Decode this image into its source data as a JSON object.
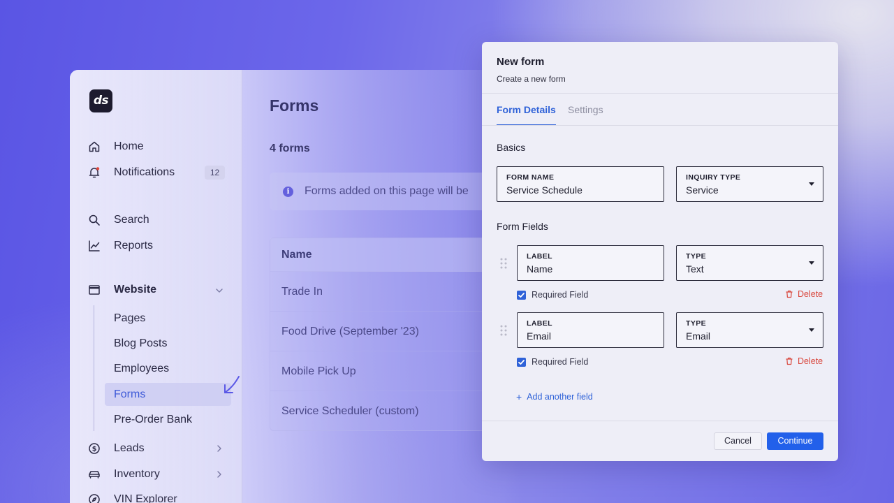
{
  "app": {
    "logo_text": "ds",
    "nav": {
      "home": "Home",
      "notifications": "Notifications",
      "notifications_count": "12",
      "search": "Search",
      "reports": "Reports",
      "website": "Website",
      "leads": "Leads",
      "inventory": "Inventory",
      "vin_explorer": "VIN Explorer"
    },
    "website_subnav": [
      "Pages",
      "Blog Posts",
      "Employees",
      "Forms",
      "Pre-Order Bank"
    ],
    "active_subnav": "Forms"
  },
  "main": {
    "title": "Forms",
    "count": "4 forms",
    "notice": "Forms added on this page will be",
    "table_header": "Name",
    "rows": [
      "Trade In",
      "Food Drive (September '23)",
      "Mobile Pick Up",
      "Service Scheduler (custom)"
    ]
  },
  "modal": {
    "title": "New form",
    "subtitle": "Create a new form",
    "tabs": [
      "Form Details",
      "Settings"
    ],
    "basics_heading": "Basics",
    "form_name": {
      "label": "FORM NAME",
      "value": "Service Schedule"
    },
    "inquiry_type": {
      "label": "INQUIRY TYPE",
      "value": "Service"
    },
    "fields_heading": "Form Fields",
    "fields": [
      {
        "label_caption": "LABEL",
        "label_value": "Name",
        "type_caption": "TYPE",
        "type_value": "Text",
        "required_text": "Required Field",
        "required": true,
        "delete_text": "Delete"
      },
      {
        "label_caption": "LABEL",
        "label_value": "Email",
        "type_caption": "TYPE",
        "type_value": "Email",
        "required_text": "Required Field",
        "required": true,
        "delete_text": "Delete"
      }
    ],
    "add_field": "Add another field",
    "cancel": "Cancel",
    "continue": "Continue"
  },
  "colors": {
    "accent": "#2f62d8",
    "primary_button": "#2260ea",
    "danger": "#d9483e",
    "logo_bg": "#1d1b2e"
  }
}
